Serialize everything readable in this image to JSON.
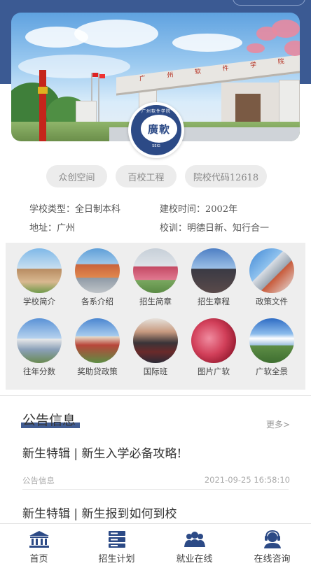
{
  "hero": {
    "gate_sign": "广 州 软 件 学 院",
    "seal_main": "廣軟",
    "seal_arc": "广州软件学院",
    "seal_year": "SEIG"
  },
  "tags": [
    "众创空间",
    "百校工程",
    "院校代码12618"
  ],
  "info": {
    "school_type": "学校类型：全日制本科",
    "founded": "建校时间：2002年",
    "address": "地址：广州",
    "motto": "校训：明德日新、知行合一"
  },
  "grid": [
    {
      "label": "学校简介",
      "icon": "school-intro-photo"
    },
    {
      "label": "各系介绍",
      "icon": "department-photo"
    },
    {
      "label": "招生简章",
      "icon": "admission-guide-photo"
    },
    {
      "label": "招生章程",
      "icon": "admission-charter-photo"
    },
    {
      "label": "政策文件",
      "icon": "policy-photo"
    },
    {
      "label": "往年分数",
      "icon": "past-scores-photo"
    },
    {
      "label": "奖助贷政策",
      "icon": "aid-policy-photo"
    },
    {
      "label": "国际班",
      "icon": "international-class-photo"
    },
    {
      "label": "图片广软",
      "icon": "gallery-photo"
    },
    {
      "label": "广软全景",
      "icon": "panorama-photo"
    }
  ],
  "notice": {
    "title": "公告信息",
    "more": "更多>",
    "items": [
      {
        "title": "新生特辑 | 新生入学必备攻略!",
        "category": "公告信息",
        "time": "2021-09-25 16:58:10"
      },
      {
        "title": "新生特辑 | 新生报到如何到校",
        "category": "",
        "time": ""
      }
    ]
  },
  "tabbar": [
    {
      "label": "首页",
      "icon": "bank-building-icon"
    },
    {
      "label": "招生计划",
      "icon": "server-stack-icon"
    },
    {
      "label": "就业在线",
      "icon": "group-users-icon"
    },
    {
      "label": "在线咨询",
      "icon": "headset-user-icon"
    }
  ],
  "colors": {
    "brand": "#2c4a86",
    "band": "#3b5a93",
    "panel": "#eeeeee"
  }
}
